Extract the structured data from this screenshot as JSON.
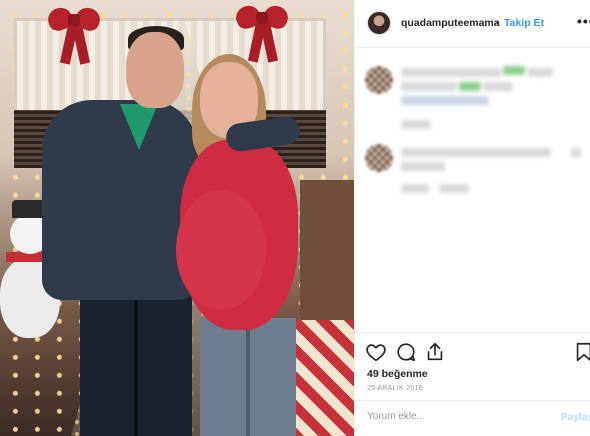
{
  "post": {
    "username": "quadamputeemama",
    "separator": "•",
    "follow_label": "Takip Et",
    "more_icon": "more-options-icon",
    "likes": "49 beğenme",
    "date": "25 ARALIK 2016"
  },
  "actions": {
    "like_icon": "heart-icon",
    "comment_icon": "comment-bubble-icon",
    "share_icon": "share-icon",
    "save_icon": "bookmark-icon"
  },
  "comment_box": {
    "placeholder": "Yorum ekle...",
    "post_label": "Paylaş"
  },
  "colors": {
    "link": "#3897f0",
    "post_button_disabled": "#b2dffc",
    "border": "#efefef"
  }
}
